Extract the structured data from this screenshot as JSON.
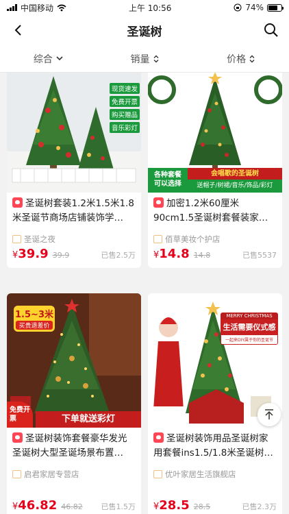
{
  "status_bar": {
    "carrier": "中国移动",
    "time": "上午 10:56",
    "battery": "74%",
    "battery_level": 0.74
  },
  "header": {
    "title": "圣诞树",
    "back_icon": "back-arrow-icon",
    "search_icon": "search-icon"
  },
  "sort_bar": {
    "items": [
      {
        "label": "综合",
        "icon": "chevron-down-icon"
      },
      {
        "label": "销量",
        "icon": "sort-updown-icon"
      },
      {
        "label": "价格",
        "icon": "sort-updown-icon"
      }
    ]
  },
  "products": [
    {
      "name": "圣诞树套装1.2米1.5米1.8米圣诞节商场店铺装饰学…",
      "shop": "圣诞之夜",
      "yen": "¥",
      "price": "39.9",
      "original": "39.9",
      "sold": "已售2.5万",
      "badges": [
        "现货速发",
        "免费开票",
        "购买赠品",
        "音乐彩灯"
      ]
    },
    {
      "name": "加密1.2米60厘米90cm1.5圣诞树套餐装家…",
      "shop": "佰草美妆个护店",
      "yen": "¥",
      "price": "14.8",
      "original": "14.8",
      "sold": "已售5537",
      "banner_left": "各种套餐\n可以选择",
      "banner_right_top": "会唱歌的圣诞树",
      "banner_right_bottom": "送帽子/树裙/音乐/饰品/彩灯"
    },
    {
      "name": "圣诞树装饰套餐豪华发光圣诞树大型圣诞场景布置…",
      "shop": "启君家居专营店",
      "yen": "¥",
      "price": "46.82",
      "original": "46.82",
      "sold": "已售1.5万",
      "badge_top": "1.5~3米",
      "badge_top_sub": "买贵退差价",
      "badge_corner": "免费开票",
      "banner_bottom": "下单就送彩灯"
    },
    {
      "name": "圣诞树装饰用品圣诞树家用套餐ins1.5/1.8米圣诞树…",
      "shop": "优叶家居生活旗舰店",
      "yen": "¥",
      "price": "28.5",
      "original": "28.5",
      "sold": "已售2.3万",
      "banner_top": "MERRY CHRISTMAS",
      "banner_main": "生活需要仪式感",
      "banner_sub": "一起来DIY属于你的圣诞节"
    }
  ],
  "colors": {
    "price_red": "#e5001b",
    "tag_red": "#ff4655",
    "green": "#1a9a3c"
  }
}
